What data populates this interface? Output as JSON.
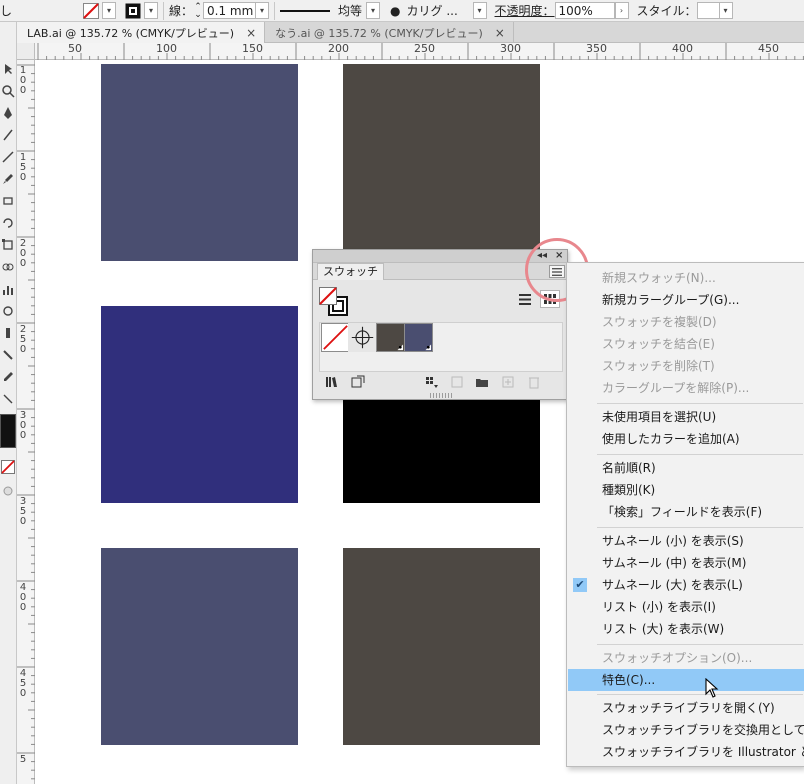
{
  "control_bar": {
    "stroke_label": "線：",
    "stroke_value": "0.1 mm",
    "profile_label": "均等",
    "brush_label": "カリグ ...",
    "opacity_label": "不透明度：",
    "opacity_value": "100%",
    "style_label": "スタイル："
  },
  "doc_tabs": [
    {
      "title": "LAB.ai @ 135.72 % (CMYK/プレビュー)",
      "close": "×",
      "active": true
    },
    {
      "title": "なう.ai @ 135.72 % (CMYK/プレビュー)",
      "close": "×",
      "active": false
    }
  ],
  "ruler": {
    "h_labels": [
      "50",
      "100",
      "150",
      "200",
      "250",
      "300",
      "350",
      "400",
      "450"
    ],
    "v_labels": [
      [
        "1",
        "0",
        "0"
      ],
      [
        "1",
        "5",
        "0"
      ],
      [
        "2",
        "0",
        "0"
      ],
      [
        "2",
        "5",
        "0"
      ],
      [
        "3",
        "0",
        "0"
      ],
      [
        "3",
        "5",
        "0"
      ],
      [
        "4",
        "0",
        "0"
      ],
      [
        "4",
        "5",
        "0"
      ],
      [
        "5"
      ]
    ]
  },
  "canvas_swatches": [
    {
      "color": "#4a4e70"
    },
    {
      "color": "#4d4843"
    },
    {
      "color": "#302f7c"
    },
    {
      "color": "#000000"
    },
    {
      "color": "#4a4e70"
    },
    {
      "color": "#4d4843"
    }
  ],
  "swatch_panel": {
    "collapse_icon": "◂◂",
    "close_icon": "×",
    "tab_label": "スウォッチ",
    "swatches": [
      {
        "name": "none",
        "color": "#ffffff"
      },
      {
        "name": "registration",
        "color": "#ffffff"
      },
      {
        "name": "spot-1",
        "color": "#4d4843"
      },
      {
        "name": "spot-2",
        "color": "#4a4e70"
      }
    ]
  },
  "flyout_menu": {
    "items": [
      {
        "label": "新規スウォッチ(N)...",
        "enabled": false
      },
      {
        "label": "新規カラーグループ(G)...",
        "enabled": true
      },
      {
        "label": "スウォッチを複製(D)",
        "enabled": false
      },
      {
        "label": "スウォッチを結合(E)",
        "enabled": false
      },
      {
        "label": "スウォッチを削除(T)",
        "enabled": false
      },
      {
        "label": "カラーグループを解除(P)...",
        "enabled": false
      },
      {
        "label": "未使用項目を選択(U)",
        "enabled": true
      },
      {
        "label": "使用したカラーを追加(A)",
        "enabled": true
      },
      {
        "label": "名前順(R)",
        "enabled": true
      },
      {
        "label": "種類別(K)",
        "enabled": true
      },
      {
        "label": "「検索」フィールドを表示(F)",
        "enabled": true
      },
      {
        "label": "サムネール (小) を表示(S)",
        "enabled": true
      },
      {
        "label": "サムネール (中) を表示(M)",
        "enabled": true
      },
      {
        "label": "サムネール (大) を表示(L)",
        "enabled": true,
        "checked": true
      },
      {
        "label": "リスト (小) を表示(I)",
        "enabled": true
      },
      {
        "label": "リスト (大) を表示(W)",
        "enabled": true
      },
      {
        "label": "スウォッチオプション(O)...",
        "enabled": false
      },
      {
        "label": "特色(C)...",
        "enabled": true,
        "highlighted": true
      },
      {
        "label": "スウォッチライブラリを開く(Y)",
        "enabled": true
      },
      {
        "label": "スウォッチライブラリを交換用として保存(V)...",
        "enabled": true
      },
      {
        "label": "スウォッチライブラリを Illustrator として保存(I)...",
        "enabled": true
      }
    ],
    "check_icon": "✔"
  }
}
